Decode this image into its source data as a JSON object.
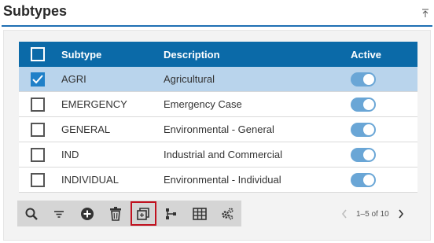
{
  "header": {
    "title": "Subtypes"
  },
  "grid": {
    "columns": {
      "subtype": "Subtype",
      "description": "Description",
      "active": "Active"
    },
    "rows": [
      {
        "subtype": "AGRI",
        "description": "Agricultural",
        "active": true,
        "selected": true
      },
      {
        "subtype": "EMERGENCY",
        "description": "Emergency Case",
        "active": true,
        "selected": false
      },
      {
        "subtype": "GENERAL",
        "description": "Environmental - General",
        "active": true,
        "selected": false
      },
      {
        "subtype": "IND",
        "description": "Industrial and Commercial",
        "active": true,
        "selected": false
      },
      {
        "subtype": "INDIVIDUAL",
        "description": "Environmental - Individual",
        "active": true,
        "selected": false
      }
    ]
  },
  "toolbar": {
    "icons": [
      "search-icon",
      "filter-icon",
      "add-icon",
      "delete-icon",
      "copy-icon",
      "hierarchy-icon",
      "table-icon",
      "settings-icon"
    ],
    "highlighted": "copy-icon"
  },
  "pager": {
    "label": "1–5 of 10"
  },
  "colors": {
    "header_bg": "#0b6aa8",
    "accent": "#1f80c8",
    "selected_row": "#b9d4ec",
    "toggle_on": "#6aa6d6",
    "highlight": "#c0111f"
  }
}
